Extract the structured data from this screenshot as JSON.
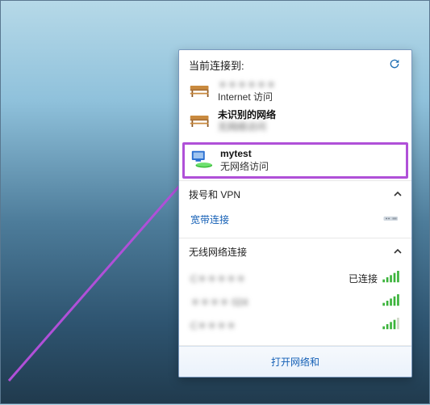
{
  "header": {
    "title": "当前连接到:"
  },
  "connections": [
    {
      "name_blurred": true,
      "name": "＊＊＊＊＊＊",
      "sub": "Internet 访问",
      "icon": "bench"
    },
    {
      "name": "未识别的网络",
      "sub": "无网络访问",
      "icon": "bench",
      "sub_blurred": true
    }
  ],
  "highlighted": {
    "name": "mytest",
    "sub": "无网络访问"
  },
  "dialup": {
    "header": "拨号和 VPN",
    "item": "宽带连接"
  },
  "wireless": {
    "header": "无线网络连接",
    "connected_label": "已连接",
    "items": [
      {
        "name": "C＊＊＊＊＊",
        "connected": true,
        "bars": 5
      },
      {
        "name": "＊＊＊＊ 024",
        "connected": false,
        "bars": 5
      },
      {
        "name": "C＊＊＊＊",
        "connected": false,
        "bars": 4
      }
    ]
  },
  "footer": {
    "link": "打开网络和"
  }
}
